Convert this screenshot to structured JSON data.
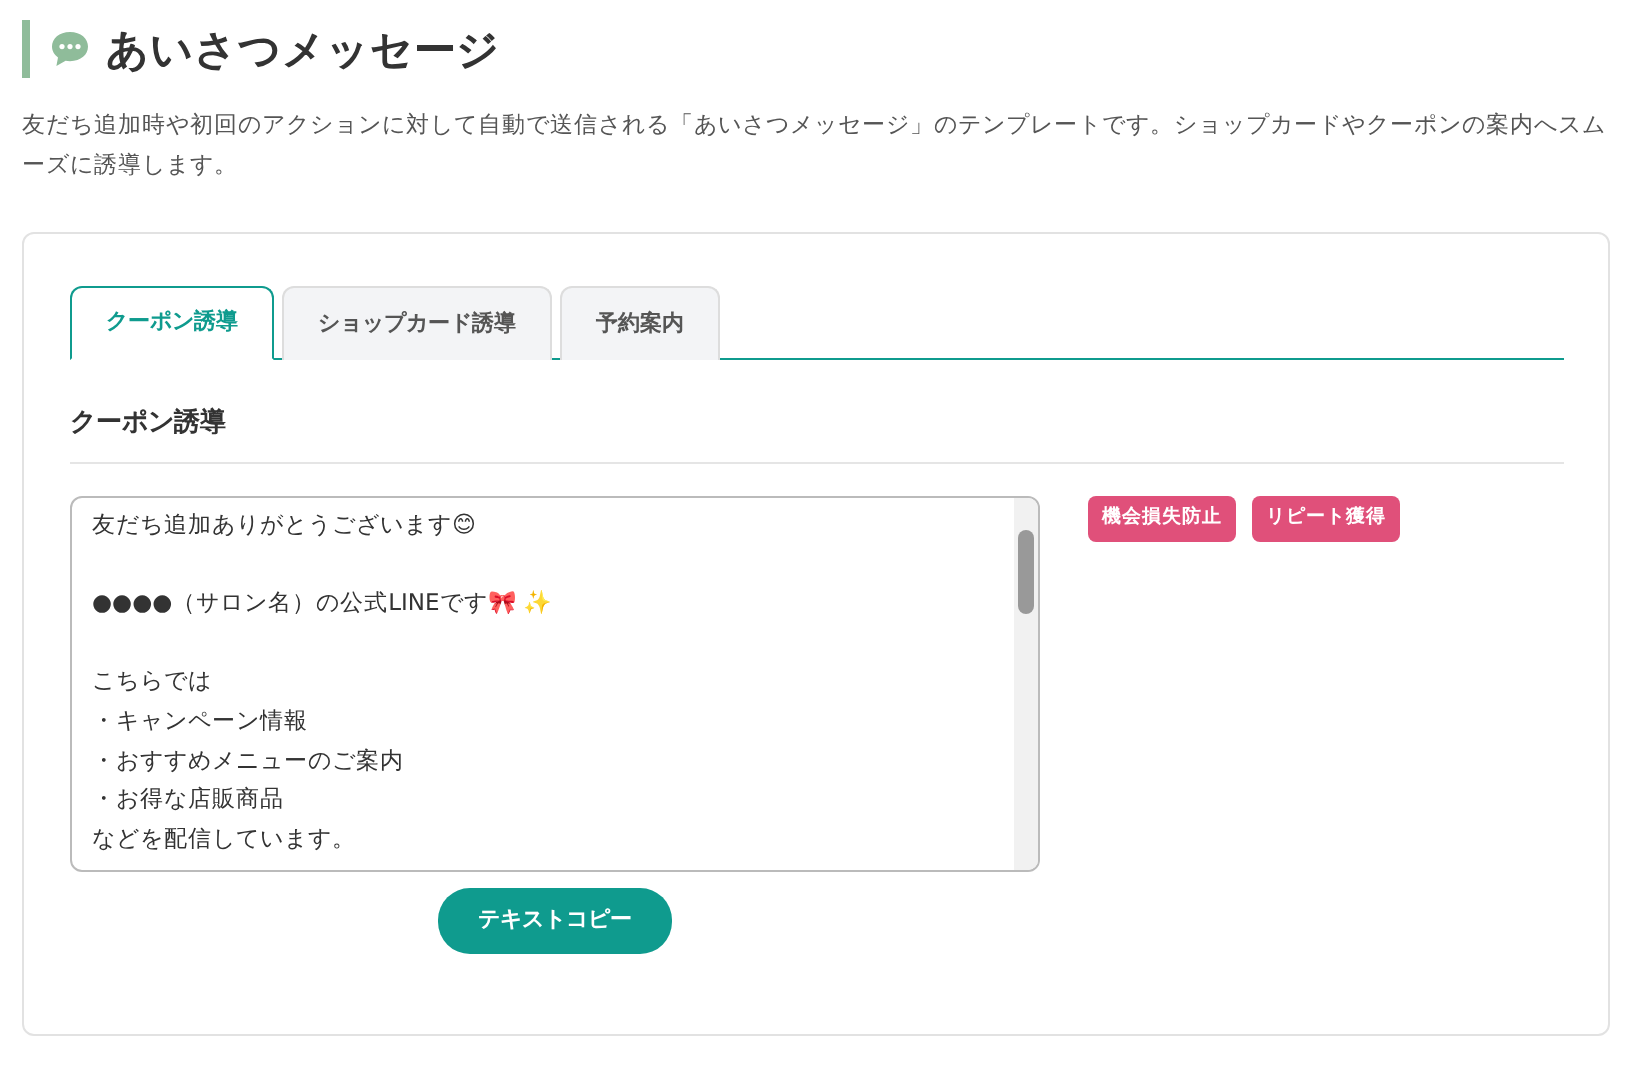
{
  "title": "あいさつメッセージ",
  "description": "友だち追加時や初回のアクションに対して自動で送信される「あいさつメッセージ」のテンプレートです。ショップカードやクーポンの案内へスムーズに誘導します。",
  "tabs": [
    {
      "label": "クーポン誘導",
      "selected": true
    },
    {
      "label": "ショップカード誘導",
      "selected": false
    },
    {
      "label": "予約案内",
      "selected": false
    }
  ],
  "section_title": "クーポン誘導",
  "message_lines": [
    "友だち追加ありがとうございます😊",
    "●●●●（サロン名）の公式LINEです🎀 ✨",
    "こちらでは",
    "・キャンペーン情報",
    "・おすすめメニューのご案内",
    "・お得な店販商品",
    "などを配信しています。"
  ],
  "tags": [
    {
      "label": "機会損失防止",
      "color": "#e0507a"
    },
    {
      "label": "リピート獲得",
      "color": "#e0507a"
    }
  ],
  "copy_button": "テキストコピー"
}
